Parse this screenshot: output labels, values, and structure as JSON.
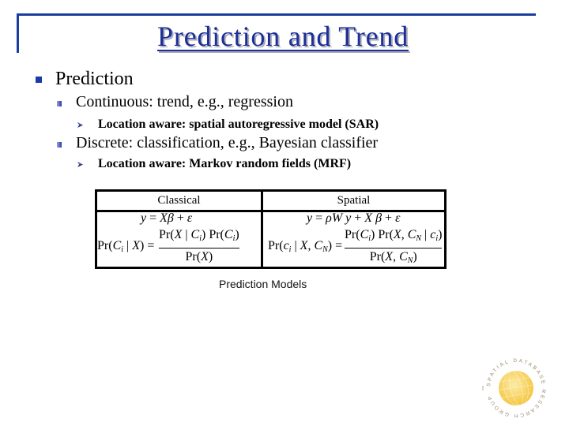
{
  "theme": {
    "accent": "#1c2f98",
    "rule": "#1a3ea0",
    "bullet": "#1c3aa8"
  },
  "slide": {
    "title": "Prediction and Trend"
  },
  "outline": [
    {
      "bullet_icon": "square-bullet",
      "text": "Prediction",
      "children": [
        {
          "bullet_icon": "small-square-bullet",
          "text": "Continuous: trend, e.g., regression",
          "children": [
            {
              "bullet_icon": "arrow-bullet",
              "text": "Location aware: spatial autoregressive model (SAR)"
            }
          ]
        },
        {
          "bullet_icon": "small-square-bullet",
          "text": "Discrete: classification, e.g., Bayesian classifier",
          "children": [
            {
              "bullet_icon": "arrow-bullet",
              "text": "Location aware: Markov random fields (MRF)"
            }
          ]
        }
      ]
    }
  ],
  "comparison_table": {
    "caption": "Prediction Models",
    "columns": [
      {
        "header": "Classical",
        "model_equation": [
          [
            "y",
            "i"
          ],
          [
            " = ",
            "r"
          ],
          [
            "X",
            "i"
          ],
          [
            "β",
            "i"
          ],
          [
            " + ",
            "r"
          ],
          [
            "ε",
            "i"
          ]
        ],
        "classifier_equation": {
          "lhs": [
            [
              "Pr(",
              "r"
            ],
            [
              "C",
              "i"
            ],
            [
              "i",
              "b"
            ],
            [
              " | ",
              "r"
            ],
            [
              "X",
              "i"
            ],
            [
              ") = ",
              "r"
            ]
          ],
          "numerator": [
            [
              "Pr(",
              "r"
            ],
            [
              "X",
              "i"
            ],
            [
              " | ",
              "r"
            ],
            [
              "C",
              "i"
            ],
            [
              "i",
              "b"
            ],
            [
              ") Pr(",
              "r"
            ],
            [
              "C",
              "i"
            ],
            [
              "i",
              "b"
            ],
            [
              ")",
              "r"
            ]
          ],
          "denominator": [
            [
              "Pr(",
              "r"
            ],
            [
              "X",
              "i"
            ],
            [
              ")",
              "r"
            ]
          ]
        }
      },
      {
        "header": "Spatial",
        "model_equation": [
          [
            "y",
            "i"
          ],
          [
            " = ",
            "r"
          ],
          [
            "ρ",
            "i"
          ],
          [
            "W",
            "i"
          ],
          [
            " y",
            "i"
          ],
          [
            " + ",
            "r"
          ],
          [
            "X",
            "i"
          ],
          [
            " β",
            "i"
          ],
          [
            " + ",
            "r"
          ],
          [
            "ε",
            "i"
          ]
        ],
        "classifier_equation": {
          "lhs": [
            [
              "Pr(",
              "r"
            ],
            [
              "c",
              "i"
            ],
            [
              "i",
              "b"
            ],
            [
              " | ",
              "r"
            ],
            [
              "X",
              "i"
            ],
            [
              ", ",
              "r"
            ],
            [
              "C",
              "i"
            ],
            [
              "N",
              "b"
            ],
            [
              ") = ",
              "r"
            ]
          ],
          "numerator": [
            [
              "Pr(",
              "r"
            ],
            [
              "C",
              "i"
            ],
            [
              "i",
              "b"
            ],
            [
              ") Pr(",
              "r"
            ],
            [
              "X",
              "i"
            ],
            [
              ", ",
              "r"
            ],
            [
              "C",
              "i"
            ],
            [
              "N",
              "b"
            ],
            [
              " | ",
              "r"
            ],
            [
              "c",
              "i"
            ],
            [
              "i",
              "b"
            ],
            [
              ")",
              "r"
            ]
          ],
          "denominator": [
            [
              "Pr(",
              "r"
            ],
            [
              "X",
              "i"
            ],
            [
              ", ",
              "r"
            ],
            [
              "C",
              "i"
            ],
            [
              "N",
              "b"
            ],
            [
              ")",
              "r"
            ]
          ]
        }
      }
    ]
  },
  "logo": {
    "icon": "globe",
    "ring_text": "SPATIAL DATABASE RESEARCH GROUP"
  }
}
